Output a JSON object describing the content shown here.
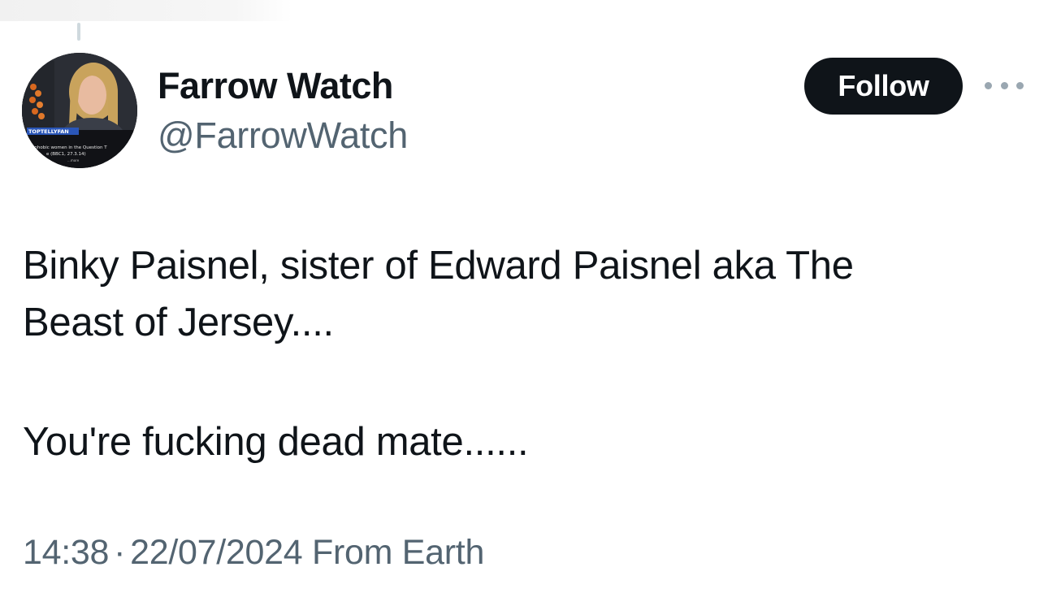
{
  "tweet": {
    "author": {
      "display_name": "Farrow Watch",
      "handle": "@FarrowWatch",
      "avatar": {
        "overlay_logo_text": "TOPTELLYFAN",
        "caption_line_1": "ophobic women in the Question T",
        "caption_line_2": "e (BBC1, 27.3.14)",
        "caption_line_3": "...more"
      }
    },
    "actions": {
      "follow_label": "Follow",
      "more_icon": "more-horizontal-icon"
    },
    "body": {
      "paragraph_1_line_1": "Binky Paisnel, sister of Edward Paisnel aka The",
      "paragraph_1_line_2": "Beast of Jersey....",
      "paragraph_2": "You're fucking dead mate......"
    },
    "meta": {
      "time": "14:38",
      "separator": "·",
      "date": "22/07/2024",
      "source": "From Earth"
    }
  },
  "colors": {
    "text_primary": "#0f1419",
    "text_secondary": "#536471",
    "follow_bg": "#0f1419",
    "follow_text": "#ffffff"
  }
}
